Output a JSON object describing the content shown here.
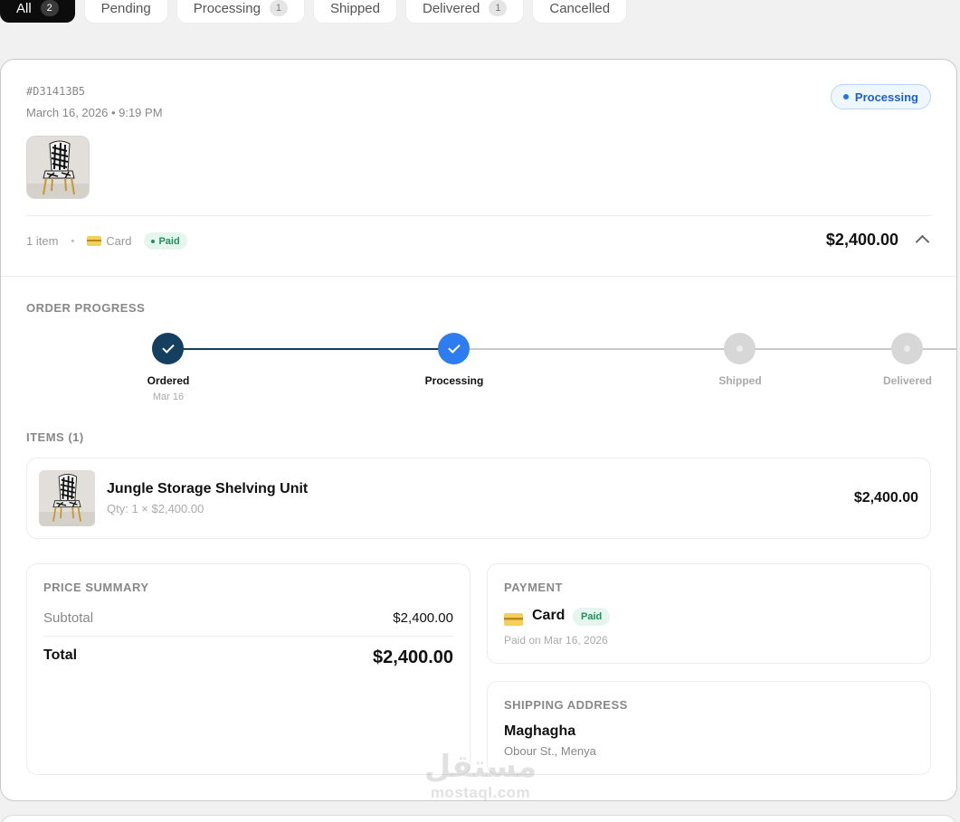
{
  "tabs": [
    {
      "label": "All",
      "count": "2"
    },
    {
      "label": "Pending",
      "count": ""
    },
    {
      "label": "Processing",
      "count": "1"
    },
    {
      "label": "Shipped",
      "count": ""
    },
    {
      "label": "Delivered",
      "count": "1"
    },
    {
      "label": "Cancelled",
      "count": ""
    }
  ],
  "order": {
    "id": "#D31413B5",
    "date": "March 16, 2026 • 9:19 PM",
    "status": "Processing",
    "item_count": "1 item",
    "meta_sep": "•",
    "payment_method": "Card",
    "payment_status": "Paid",
    "total": "$2,400.00"
  },
  "progress": {
    "label": "ORDER PROGRESS",
    "steps": [
      {
        "label": "Ordered",
        "date": "Mar 16",
        "state": "done"
      },
      {
        "label": "Processing",
        "date": "",
        "state": "current"
      },
      {
        "label": "Shipped",
        "date": "",
        "state": "pending"
      },
      {
        "label": "Delivered",
        "date": "",
        "state": "pending"
      }
    ]
  },
  "items": {
    "label": "ITEMS (1)",
    "list": [
      {
        "name": "Jungle Storage Shelving Unit",
        "qty": "Qty: 1 × $2,400.00",
        "price": "$2,400.00"
      }
    ]
  },
  "price_summary": {
    "label": "PRICE SUMMARY",
    "subtotal_label": "Subtotal",
    "subtotal": "$2,400.00",
    "total_label": "Total",
    "total": "$2,400.00"
  },
  "payment": {
    "label": "PAYMENT",
    "method": "Card",
    "status": "Paid",
    "paid_on": "Paid on Mar 16, 2026"
  },
  "shipping": {
    "label": "SHIPPING ADDRESS",
    "city": "Maghagha",
    "street": "Obour St., Menya"
  },
  "watermark": {
    "arabic": "مستقل",
    "latin": "mostaql.com"
  },
  "colors": {
    "progress_done": "#143f5e",
    "progress_current": "#2d7df1",
    "progress_pending": "#d7d7d7",
    "status_blue": "#1f5fc6",
    "paid_green": "#1f8f5c"
  }
}
